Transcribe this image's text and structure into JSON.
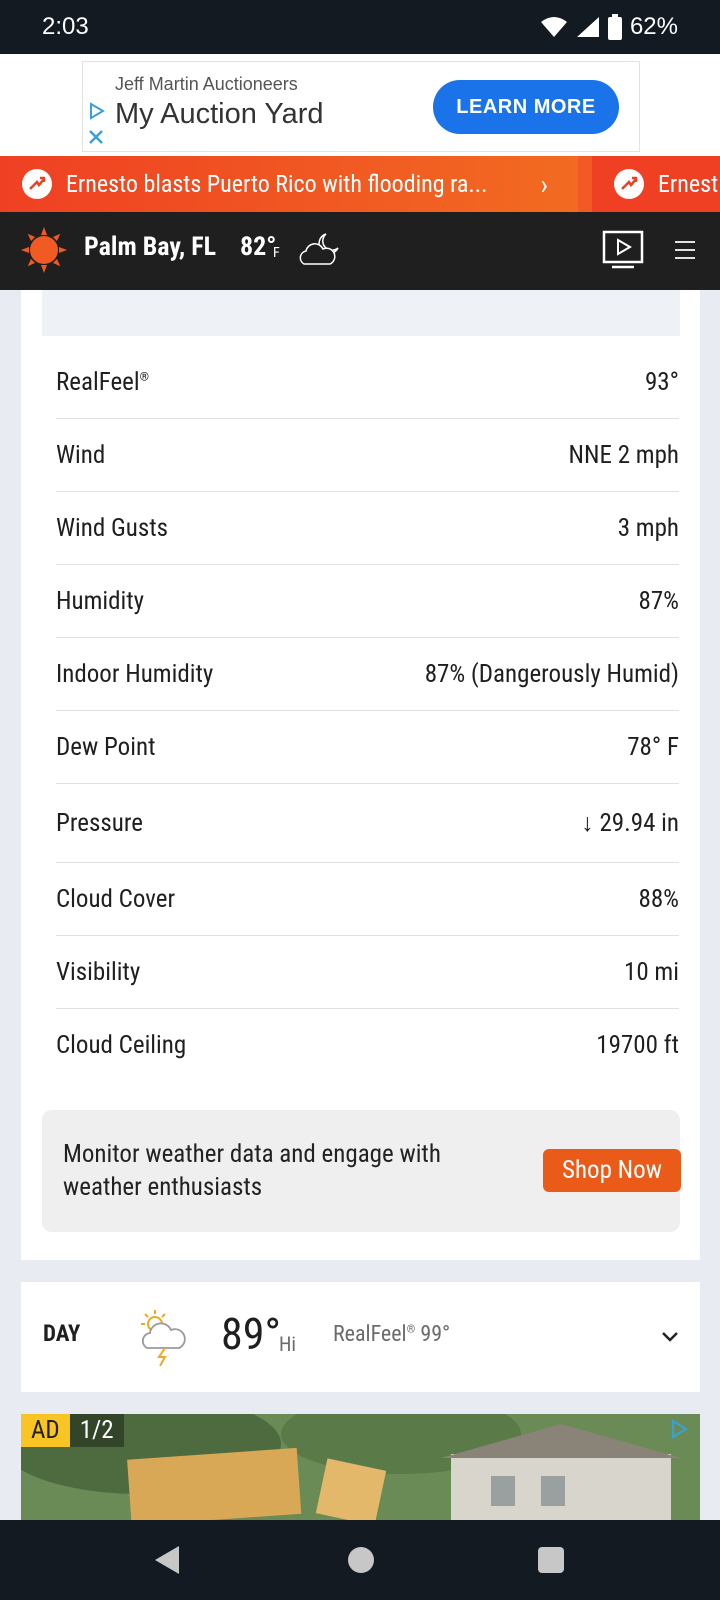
{
  "status_bar": {
    "time": "2:03",
    "battery": "62%"
  },
  "ad_banner": {
    "sponsor": "Jeff Martin Auctioneers",
    "title": "My Auction Yard",
    "cta": "LEARN MORE"
  },
  "news": [
    {
      "text": "Ernesto blasts Puerto Rico with flooding ra..."
    },
    {
      "text": "Ernest"
    }
  ],
  "header": {
    "location": "Palm Bay, FL",
    "temp": "82°",
    "unit": "F"
  },
  "details": [
    {
      "label": "RealFeel",
      "mark": "®",
      "value": "93°"
    },
    {
      "label": "Wind",
      "value": "NNE 2 mph"
    },
    {
      "label": "Wind Gusts",
      "value": "3 mph"
    },
    {
      "label": "Humidity",
      "value": "87%"
    },
    {
      "label": "Indoor Humidity",
      "value": "87% (Dangerously Humid)"
    },
    {
      "label": "Dew Point",
      "value": "78° F"
    },
    {
      "label": "Pressure",
      "value": "↓ 29.94 in"
    },
    {
      "label": "Cloud Cover",
      "value": "88%"
    },
    {
      "label": "Visibility",
      "value": "10 mi"
    },
    {
      "label": "Cloud Ceiling",
      "value": "19700 ft"
    }
  ],
  "promo": {
    "text": "Monitor weather data and engage with weather enthusiasts",
    "button": "Shop Now"
  },
  "day": {
    "label": "DAY",
    "temp": "89°",
    "hi": "Hi",
    "realfeel_label": "RealFeel",
    "realfeel_mark": "®",
    "realfeel_value": "99°"
  },
  "video_ad": {
    "badge": "AD",
    "count": "1/2"
  },
  "colors": {
    "accent": "#f15a22",
    "header_bg": "#1f1f1f",
    "cta_blue": "#1a73e8"
  },
  "icons": [
    "wifi-icon",
    "signal-icon",
    "battery-icon",
    "sun-logo-icon",
    "moon-cloud-icon",
    "video-icon",
    "menu-icon",
    "storm-icon",
    "chevron-down-icon",
    "back-icon",
    "home-icon",
    "recent-apps-icon"
  ]
}
